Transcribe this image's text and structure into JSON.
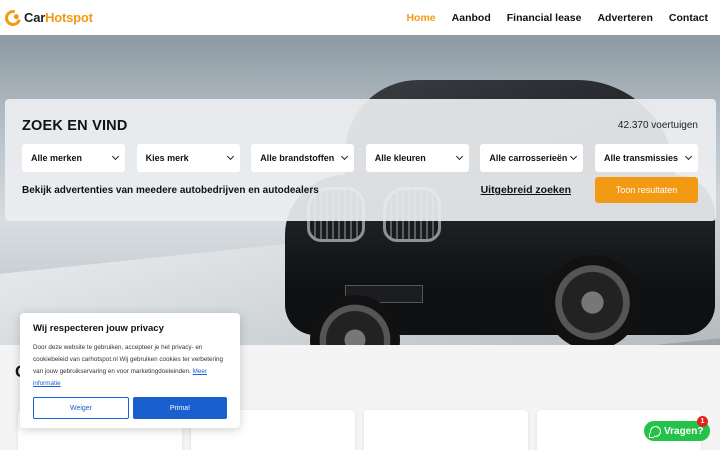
{
  "brand": {
    "part1": "Car",
    "part2": "Hotspot",
    "accent_color": "#f39a14"
  },
  "nav": [
    {
      "label": "Home",
      "active": true
    },
    {
      "label": "Aanbod",
      "active": false
    },
    {
      "label": "Financial lease",
      "active": false
    },
    {
      "label": "Adverteren",
      "active": false
    },
    {
      "label": "Contact",
      "active": false
    }
  ],
  "search": {
    "title": "ZOEK EN VIND",
    "count": "42.370 voertuigen",
    "filters": [
      {
        "label": "Alle merken"
      },
      {
        "label": "Kies merk"
      },
      {
        "label": "Alle brandstoffen"
      },
      {
        "label": "Alle kleuren"
      },
      {
        "label": "Alle carrosserieën"
      },
      {
        "label": "Alle transmissies"
      }
    ],
    "tagline": "Bekijk advertenties van meedere autobedrijven en autodealers",
    "advanced_label": "Uitgebreid zoeken",
    "submit_label": "Toon resultaten"
  },
  "section": {
    "heading_visible": "C"
  },
  "cookie": {
    "title": "Wij respecteren jouw privacy",
    "text": "Door deze website te gebruiken, accepteer je het privacy- en cookiebeleid van carhotspot.nl Wij gebruiken cookies ter verbetering van jouw gebruikservaring en voor marketingdoeleinden.",
    "link_label": "Meer informatie",
    "decline_label": "Weiger",
    "accept_label": "Prima!",
    "button_color": "#1a5fd0"
  },
  "chat": {
    "label": "Vragen?",
    "badge": "1",
    "icon": "whatsapp-icon",
    "color": "#25c24a"
  }
}
